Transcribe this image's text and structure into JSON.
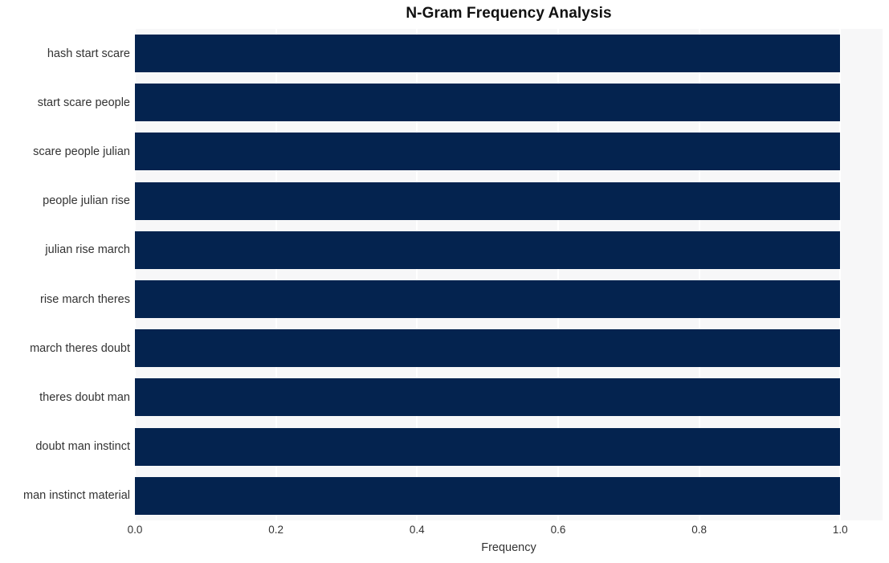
{
  "chart_data": {
    "type": "bar",
    "orientation": "horizontal",
    "title": "N-Gram Frequency Analysis",
    "xlabel": "Frequency",
    "ylabel": "",
    "categories": [
      "hash start scare",
      "start scare people",
      "scare people julian",
      "people julian rise",
      "julian rise march",
      "rise march theres",
      "march theres doubt",
      "theres doubt man",
      "doubt man instinct",
      "man instinct material"
    ],
    "values": [
      1.0,
      1.0,
      1.0,
      1.0,
      1.0,
      1.0,
      1.0,
      1.0,
      1.0,
      1.0
    ],
    "xlim": [
      0.0,
      1.06
    ],
    "xticks": [
      0.0,
      0.2,
      0.4,
      0.6,
      0.8,
      1.0
    ],
    "xtick_labels": [
      "0.0",
      "0.2",
      "0.4",
      "0.6",
      "0.8",
      "1.0"
    ],
    "grid": "vertical",
    "legend": "none",
    "bar_color": "#04234f",
    "plot_background": "#f7f7f8",
    "figure_background": "#ffffff",
    "gridline_color": "#ffffff",
    "text_color": "#333333"
  }
}
